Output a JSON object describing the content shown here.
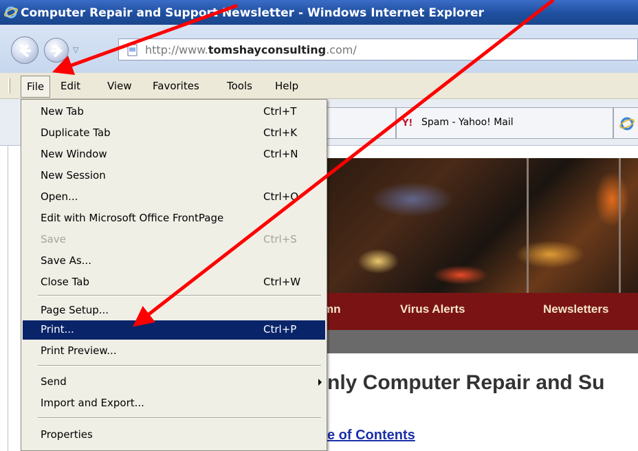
{
  "window": {
    "title": "Computer Repair and Support Newsletter - Windows Internet Explorer"
  },
  "navbar": {
    "url_prefix": "http://www.",
    "url_domain": "tomshayconsulting",
    "url_suffix": ".com/"
  },
  "menubar": {
    "items": [
      {
        "label": "File"
      },
      {
        "label": "Edit"
      },
      {
        "label": "View"
      },
      {
        "label": "Favorites"
      },
      {
        "label": "Tools"
      },
      {
        "label": "Help"
      }
    ]
  },
  "tabs": [
    {
      "label": "Spam - Yahoo! Mail"
    }
  ],
  "file_menu": {
    "items": [
      {
        "label": "New Tab",
        "shortcut": "Ctrl+T"
      },
      {
        "label": "Duplicate Tab",
        "shortcut": "Ctrl+K"
      },
      {
        "label": "New Window",
        "shortcut": "Ctrl+N"
      },
      {
        "label": "New Session",
        "shortcut": ""
      },
      {
        "label": "Open...",
        "shortcut": "Ctrl+O"
      },
      {
        "label": "Edit with Microsoft Office FrontPage",
        "shortcut": ""
      },
      {
        "label": "Save",
        "shortcut": "Ctrl+S"
      },
      {
        "label": "Save As...",
        "shortcut": ""
      },
      {
        "label": "Close Tab",
        "shortcut": "Ctrl+W"
      },
      {
        "label": "Page Setup...",
        "shortcut": ""
      },
      {
        "label": "Print...",
        "shortcut": "Ctrl+P"
      },
      {
        "label": "Print Preview...",
        "shortcut": ""
      },
      {
        "label": "Send",
        "shortcut": ""
      },
      {
        "label": "Import and Export...",
        "shortcut": ""
      },
      {
        "label": "Properties",
        "shortcut": ""
      }
    ]
  },
  "page": {
    "nav_partial": "mn",
    "nav_virus": "Virus Alerts",
    "nav_newsletters": "Newsletters",
    "heading_partial": "nly Computer Repair and Su",
    "toc_partial": "e of Contents"
  },
  "colors": {
    "annotation_arrow": "#ff0000",
    "menu_highlight": "#0a246a",
    "site_nav_bar": "#7a1414"
  }
}
